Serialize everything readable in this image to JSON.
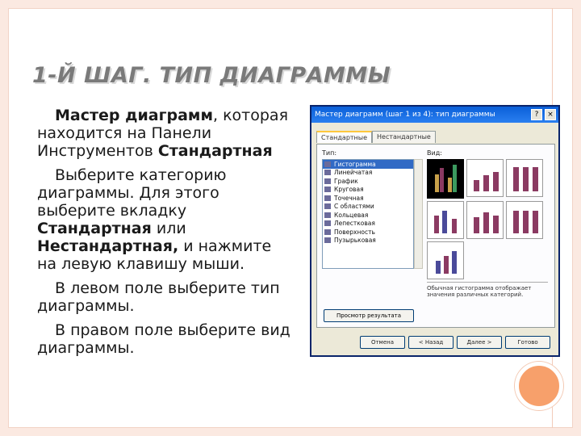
{
  "slide": {
    "title": "1-Й ШАГ. ТИП ДИАГРАММЫ",
    "p1_bold": "Мастер диаграмм",
    "p1_rest": ", которая находится на Панели Инструментов",
    "p1_bold2": "Стандартная",
    "p2_a": "Выберите категорию диаграммы. Для этого выберите вкладку",
    "p2_b1": "Стандартная",
    "p2_c": " или",
    "p2_b2": "Нестандартная,",
    "p2_d": " и нажмите на левую клавишу мыши.",
    "p3": "В левом поле выберите тип диаграммы.",
    "p4": "В правом поле выберите вид диаграммы."
  },
  "dialog": {
    "title": "Мастер диаграмм (шаг 1 из 4): тип диаграммы",
    "help": "?",
    "close": "×",
    "tabs": [
      "Стандартные",
      "Нестандартные"
    ],
    "type_label": "Тип:",
    "view_label": "Вид:",
    "types": [
      "Гистограмма",
      "Линейчатая",
      "График",
      "Круговая",
      "Точечная",
      "С областями",
      "Кольцевая",
      "Лепестковая",
      "Поверхность",
      "Пузырьковая"
    ],
    "description": "Обычная гистограмма отображает значения различных категорий.",
    "preview_button": "Просмотр результата",
    "buttons": [
      "Отмена",
      "< Назад",
      "Далее >",
      "Готово"
    ]
  }
}
